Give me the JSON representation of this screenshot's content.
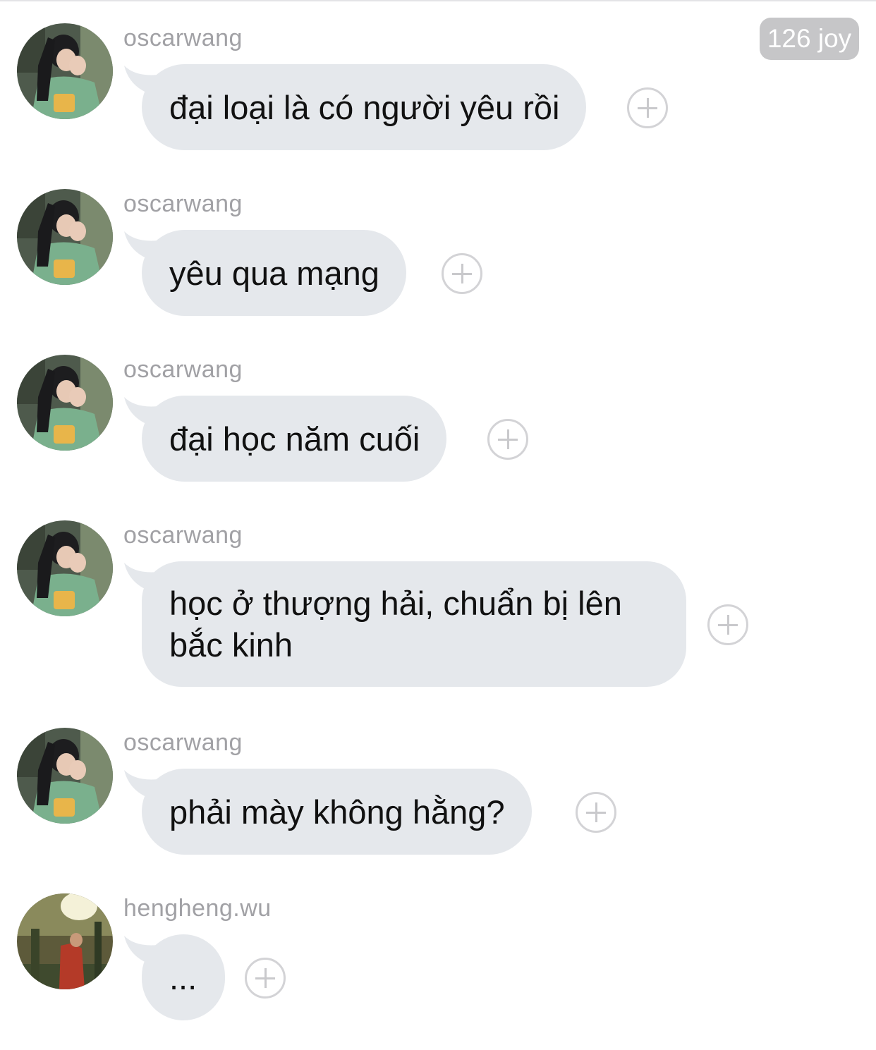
{
  "header": {
    "joy_badge": "126 joy"
  },
  "messages": [
    {
      "sender": "oscarwang",
      "text": "đại loại là có người yêu rồi",
      "avatar": "avatar-oscarwang"
    },
    {
      "sender": "oscarwang",
      "text": "yêu qua mạng",
      "avatar": "avatar-oscarwang"
    },
    {
      "sender": "oscarwang",
      "text": "đại học năm cuối",
      "avatar": "avatar-oscarwang"
    },
    {
      "sender": "oscarwang",
      "text": "học ở thượng hải, chuẩn bị lên bắc kinh",
      "avatar": "avatar-oscarwang"
    },
    {
      "sender": "oscarwang",
      "text": "phải mày không hằng?",
      "avatar": "avatar-oscarwang"
    },
    {
      "sender": "hengheng.wu",
      "text": "...",
      "avatar": "avatar-hengheng"
    }
  ],
  "icons": {
    "add_reaction": "plus-circle-icon",
    "bubble_tail": "bubble-tail-icon"
  },
  "colors": {
    "bubble": "#e5e8ec",
    "sender_text": "#a1a1a5",
    "badge_bg": "#c6c6c8",
    "badge_text": "#ffffff",
    "add_button": "#d3d3d6"
  }
}
